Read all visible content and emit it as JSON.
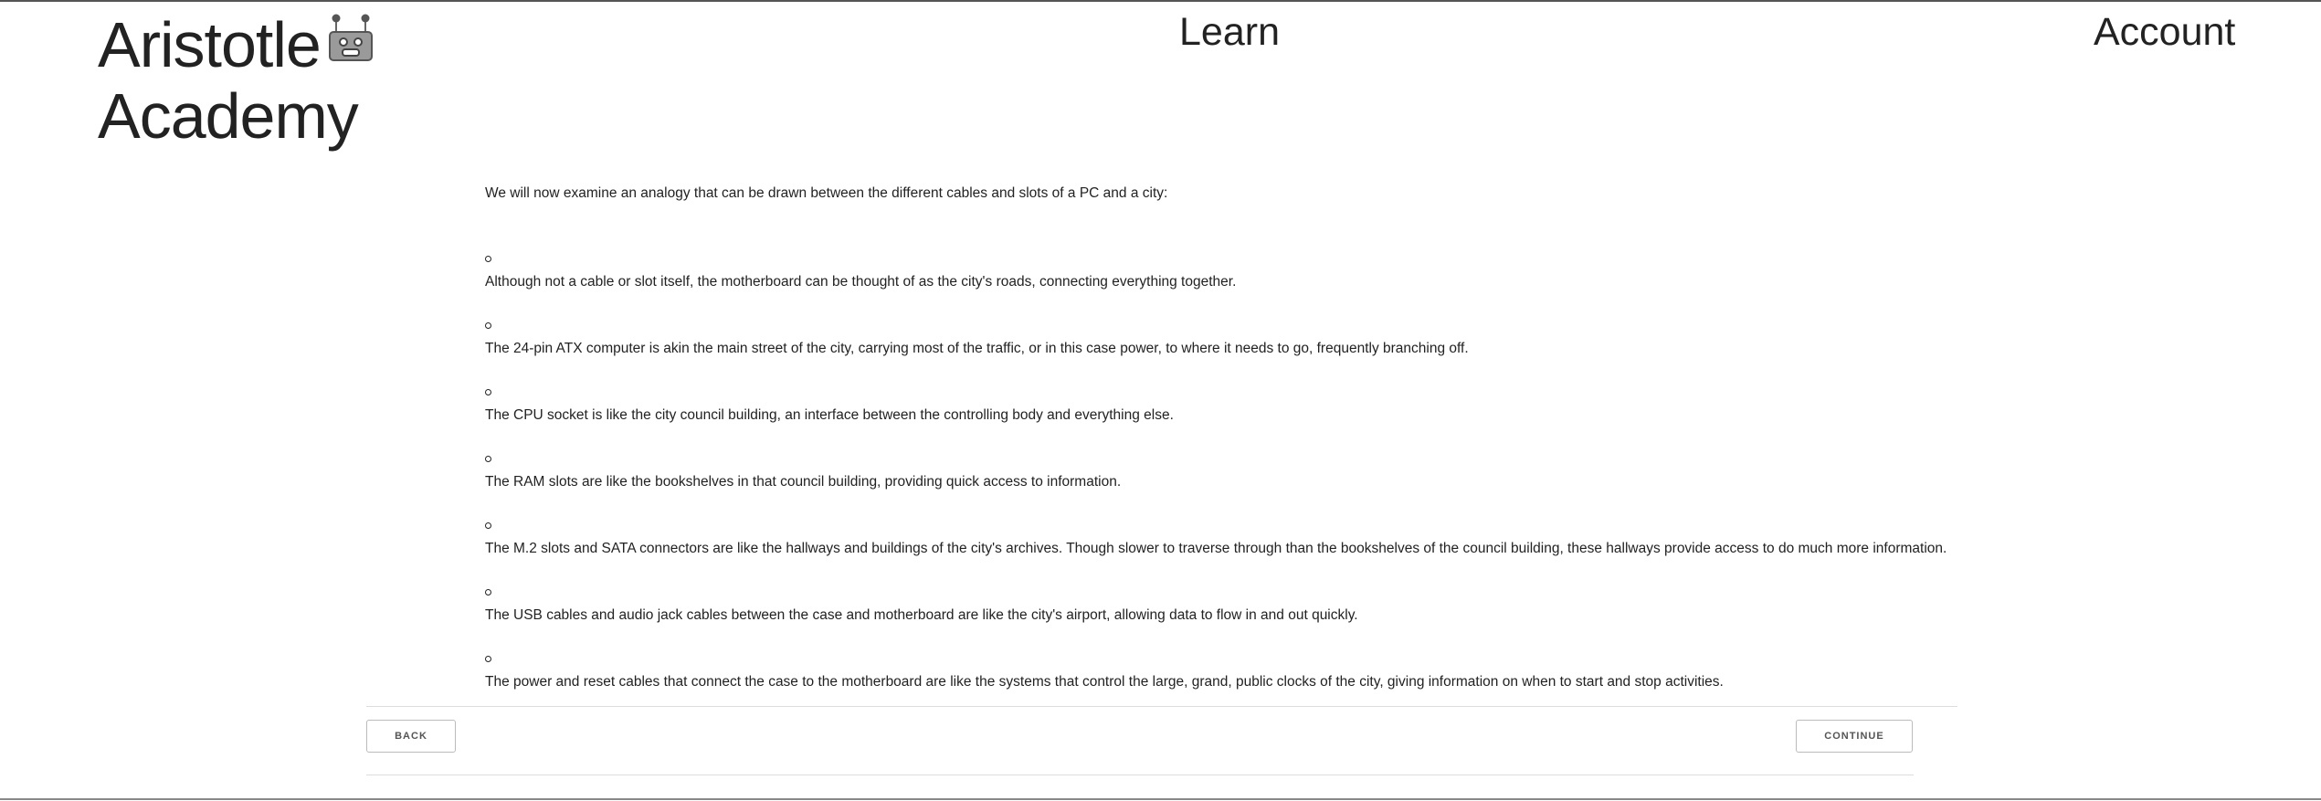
{
  "header": {
    "logo_line1": "Aristotle",
    "logo_line2": "Academy",
    "logo_icon": "robot-icon",
    "nav_learn": "Learn",
    "nav_account": "Account"
  },
  "main": {
    "intro": "We will now examine an analogy that can be drawn between the different cables and slots of a PC and a city:",
    "items": [
      "Although not a cable or slot itself, the motherboard can be thought of as the city's roads, connecting everything together.",
      "The 24-pin ATX computer is akin the main street of the city, carrying most of the traffic, or in this case power, to where it needs to go, frequently branching off.",
      "The CPU socket is like the city council building, an interface between the controlling body and everything else.",
      "The RAM slots are like the bookshelves in that council building, providing quick access to information.",
      "The M.2 slots and SATA connectors are like the hallways and buildings of the city's archives. Though slower to traverse through than the bookshelves of the council building, these hallways provide access to do much more information.",
      "The USB cables and audio jack cables between the case and motherboard are like the city's airport, allowing data to flow in and out quickly.",
      "The power and reset cables that connect the case to the motherboard are like the systems that control the large, grand, public clocks of the city, giving information on when to start and stop activities."
    ]
  },
  "footer": {
    "back_label": "BACK",
    "continue_label": "CONTINUE"
  }
}
